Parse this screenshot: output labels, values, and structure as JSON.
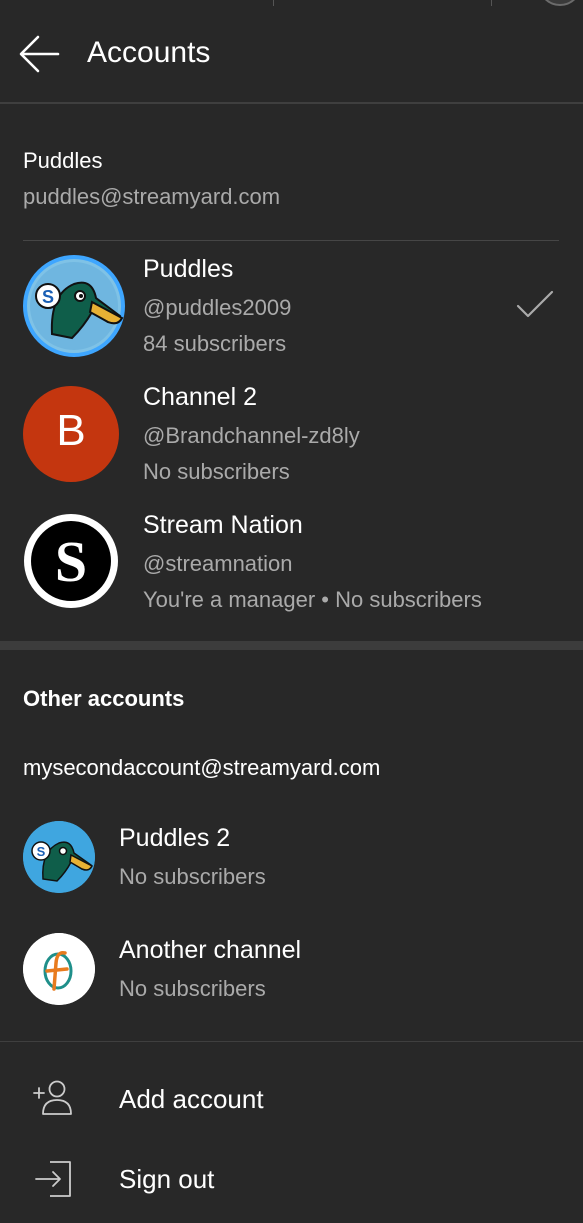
{
  "header": {
    "title": "Accounts",
    "back_icon": "arrow-left-icon"
  },
  "primary_account": {
    "name": "Puddles",
    "email": "puddles@streamyard.com",
    "channels": [
      {
        "name": "Puddles",
        "handle": "@puddles2009",
        "subscribers": "84 subscribers",
        "selected": true,
        "avatar": "duck-logo"
      },
      {
        "name": "Channel 2",
        "handle": "@Brandchannel-zd8ly",
        "subscribers": "No subscribers",
        "avatar_letter": "B",
        "avatar_color": "#c4360f"
      },
      {
        "name": "Stream Nation",
        "handle": "@streamnation",
        "subscribers": "You're a manager • No subscribers",
        "avatar_letter": "S"
      }
    ]
  },
  "other_accounts": {
    "label": "Other accounts",
    "email": "mysecondaccount@streamyard.com",
    "channels": [
      {
        "name": "Puddles 2",
        "subscribers": "No subscribers",
        "avatar": "duck-logo"
      },
      {
        "name": "Another channel",
        "subscribers": "No subscribers",
        "avatar": "f-logo"
      }
    ]
  },
  "actions": {
    "add_account": "Add account",
    "sign_out": "Sign out"
  },
  "colors": {
    "background": "#282828",
    "text_primary": "#ffffff",
    "text_secondary": "#aaaaaa",
    "selected_ring": "#3ea6ff"
  }
}
